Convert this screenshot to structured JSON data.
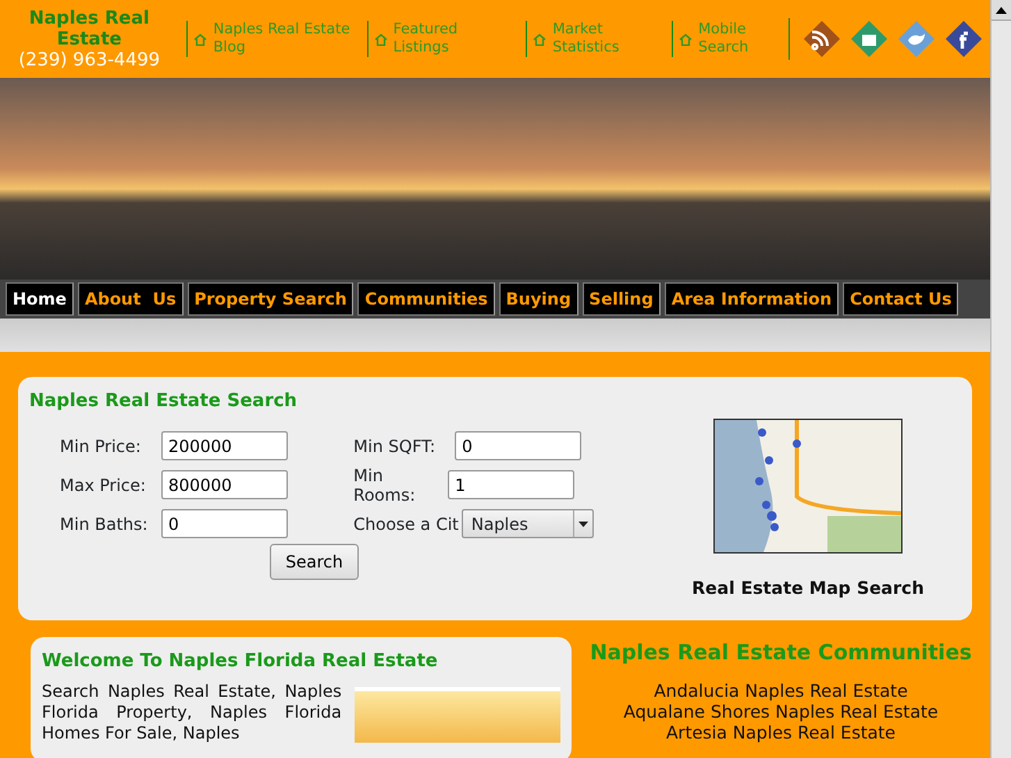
{
  "header": {
    "site_title": "Naples Real Estate",
    "phone": "(239) 963-4499",
    "links": [
      {
        "label": "Naples Real Estate Blog"
      },
      {
        "label": "Featured Listings"
      },
      {
        "label": "Market Statistics"
      },
      {
        "label": "Mobile Search"
      }
    ]
  },
  "nav": [
    {
      "label": "Home",
      "selected": true
    },
    {
      "label": "About  Us",
      "selected": false
    },
    {
      "label": "Property Search",
      "selected": false
    },
    {
      "label": "Communities",
      "selected": false
    },
    {
      "label": "Buying",
      "selected": false
    },
    {
      "label": "Selling",
      "selected": false
    },
    {
      "label": "Area Information",
      "selected": false
    },
    {
      "label": "Contact Us",
      "selected": false
    }
  ],
  "search": {
    "title": "Naples Real Estate Search",
    "left_fields": [
      {
        "kind": "text",
        "label": "Min Price:",
        "value": "200000"
      },
      {
        "kind": "text",
        "label": "Max Price:",
        "value": "800000"
      },
      {
        "kind": "text",
        "label": "Min Baths:",
        "value": "0"
      }
    ],
    "right_fields": [
      {
        "kind": "text",
        "label": "Min SQFT:",
        "value": "0"
      },
      {
        "kind": "text",
        "label": "Min Rooms:",
        "value": "1"
      },
      {
        "kind": "select",
        "label": "Choose a Cit",
        "value": "Naples"
      }
    ],
    "button": "Search",
    "map_caption": "Real Estate Map Search"
  },
  "welcome": {
    "title": "Welcome To Naples Florida Real Estate",
    "text": "Search Naples Real Estate, Naples Florida Property, Naples Florida Homes For Sale, Naples"
  },
  "communities": {
    "title": "Naples Real Estate Communities",
    "items": [
      "Andalucia Naples Real Estate",
      "Aqualane Shores Naples Real Estate",
      "Artesia Naples Real Estate"
    ]
  }
}
